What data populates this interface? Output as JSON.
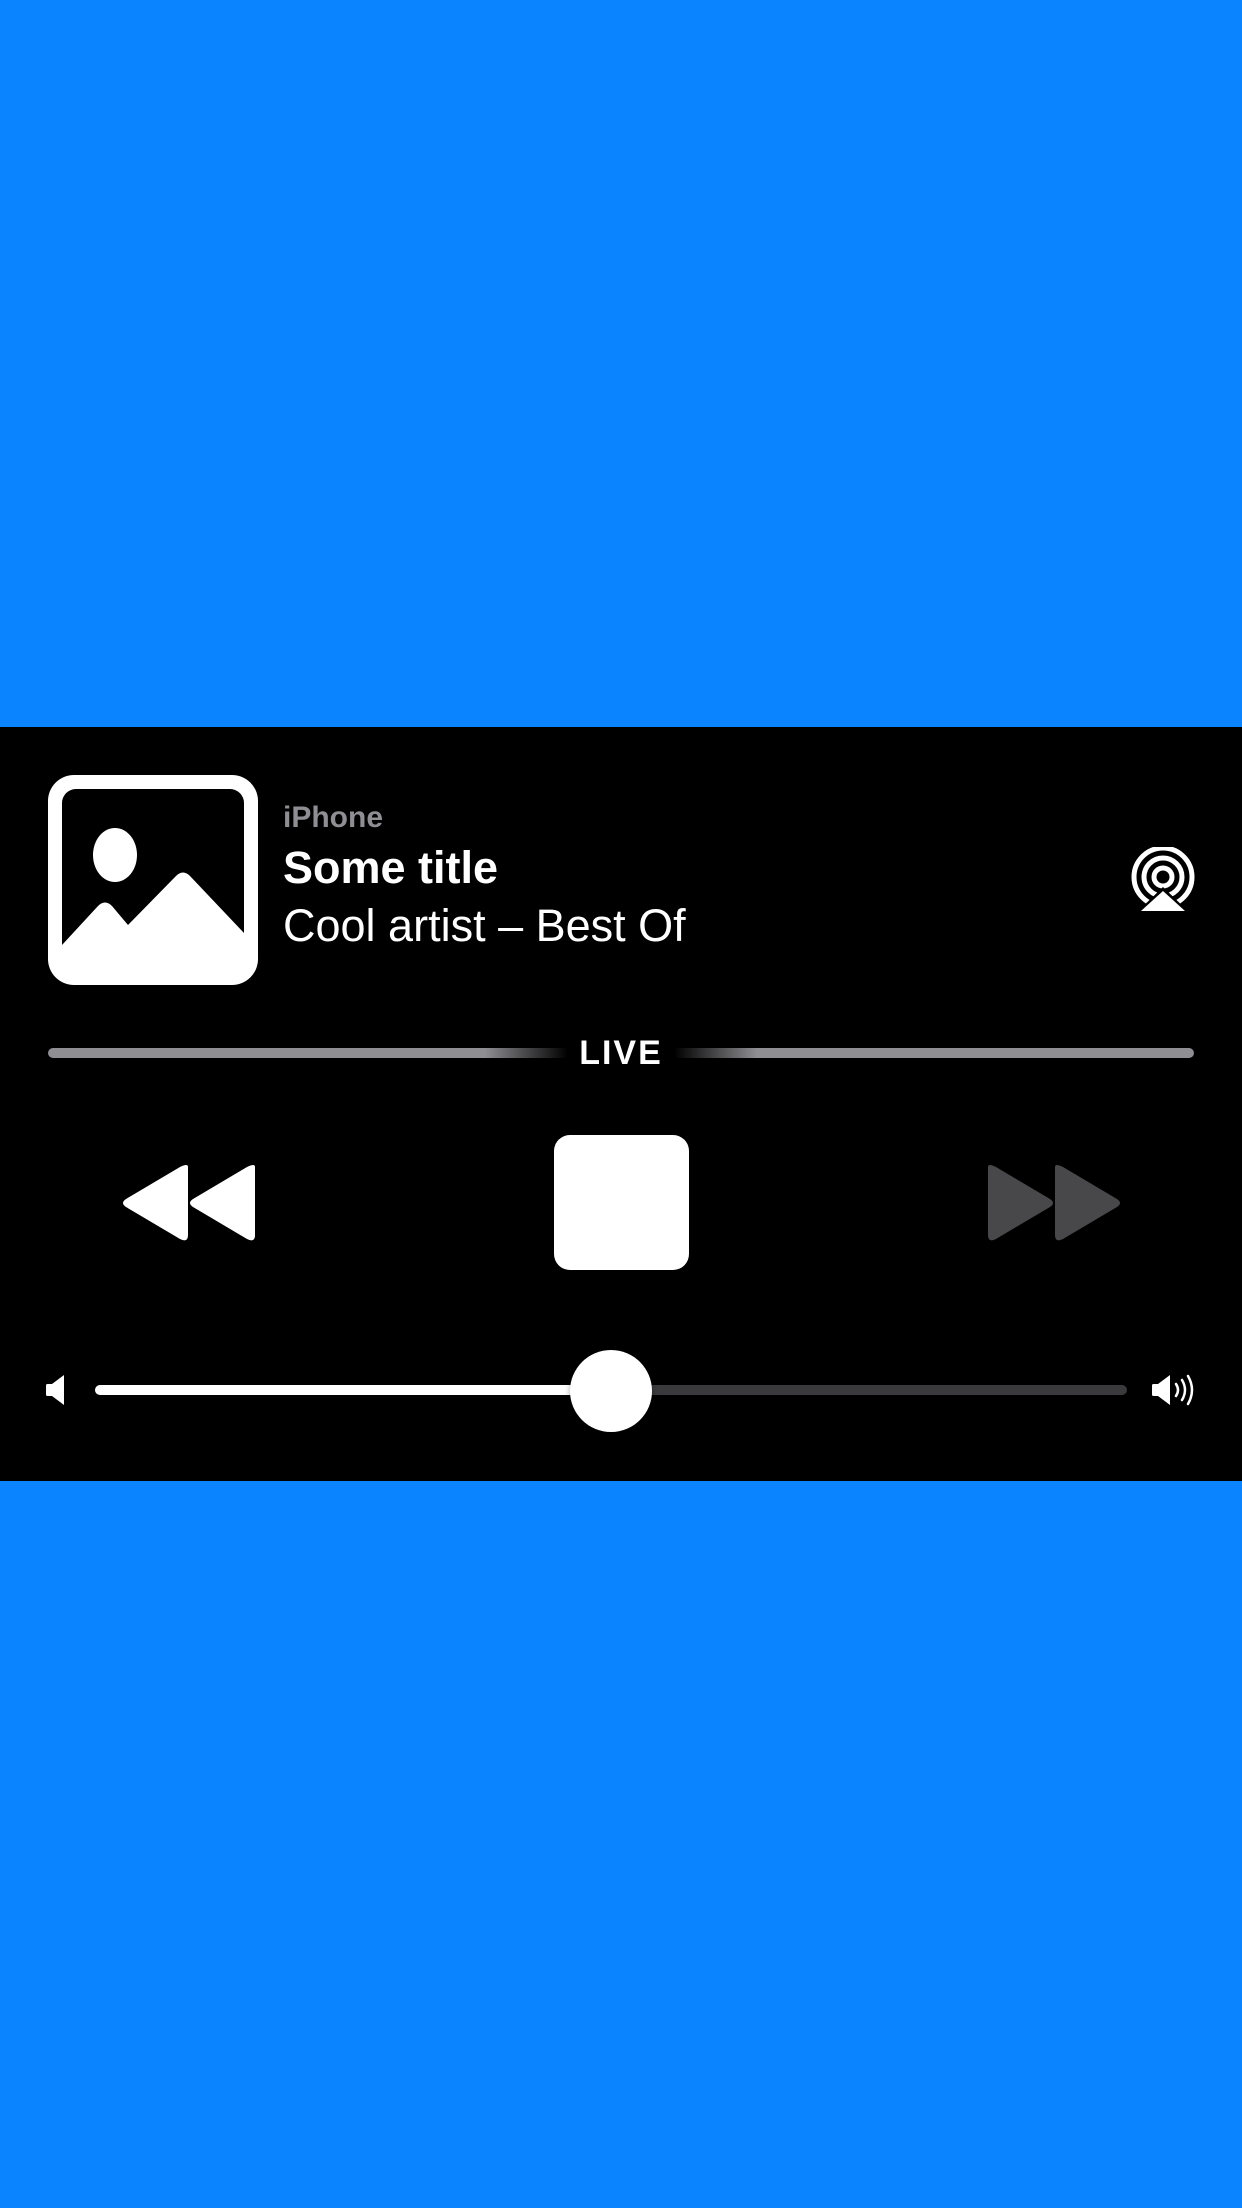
{
  "theme": {
    "background_color": "#0a84ff",
    "panel_color": "#000000",
    "secondary_text_color": "#8e8e93",
    "disabled_control_color": "#48484a"
  },
  "now_playing": {
    "device": "iPhone",
    "title": "Some title",
    "subtitle": "Cool artist – Best Of",
    "artwork_icon": "photo-placeholder-icon"
  },
  "route_button": {
    "icon": "airplay-audio-icon"
  },
  "progress": {
    "live_label": "LIVE"
  },
  "transport": {
    "rewind": {
      "icon": "backward-icon",
      "enabled": true
    },
    "stop": {
      "icon": "stop-icon",
      "enabled": true
    },
    "forward": {
      "icon": "forward-icon",
      "enabled": false
    }
  },
  "volume": {
    "level": 0.5,
    "low_icon": "speaker-low-icon",
    "high_icon": "speaker-high-icon"
  }
}
